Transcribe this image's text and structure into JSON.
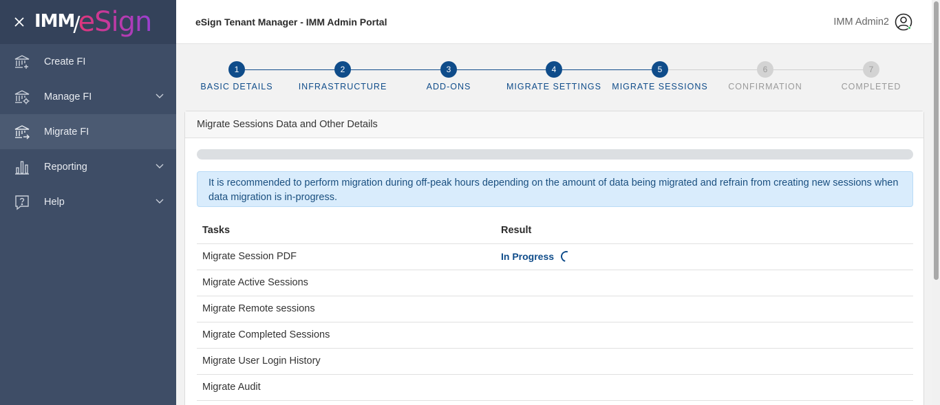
{
  "brand": {
    "imm": "IMM",
    "esign": "eSign"
  },
  "sidebar": {
    "items": [
      {
        "label": "Create FI",
        "icon": "bank-add-icon",
        "active": false,
        "expandable": false
      },
      {
        "label": "Manage FI",
        "icon": "bank-gear-icon",
        "active": false,
        "expandable": true
      },
      {
        "label": "Migrate FI",
        "icon": "bank-migrate-icon",
        "active": true,
        "expandable": false
      },
      {
        "label": "Reporting",
        "icon": "bar-chart-icon",
        "active": false,
        "expandable": true
      },
      {
        "label": "Help",
        "icon": "help-icon",
        "active": false,
        "expandable": true
      }
    ]
  },
  "header": {
    "title": "eSign Tenant Manager - IMM Admin Portal",
    "user_name": "IMM Admin2"
  },
  "stepper": {
    "steps": [
      {
        "number": "1",
        "label": "BASIC DETAILS",
        "state": "done"
      },
      {
        "number": "2",
        "label": "INFRASTRUCTURE",
        "state": "done"
      },
      {
        "number": "3",
        "label": "ADD-ONS",
        "state": "done"
      },
      {
        "number": "4",
        "label": "MIGRATE SETTINGS",
        "state": "done"
      },
      {
        "number": "5",
        "label": "MIGRATE SESSIONS",
        "state": "current"
      },
      {
        "number": "6",
        "label": "CONFIRMATION",
        "state": "pending"
      },
      {
        "number": "7",
        "label": "COMPLETED",
        "state": "pending"
      }
    ]
  },
  "card": {
    "title": "Migrate Sessions Data and Other Details",
    "progress_percent": 0,
    "alert": "It is recommended to perform migration during off-peak hours depending on the amount of data being migrated and refrain from creating new sessions when data migration is in-progress.",
    "table": {
      "headers": [
        "Tasks",
        "Result"
      ],
      "rows": [
        {
          "task": "Migrate Session PDF",
          "result": "In Progress"
        },
        {
          "task": "Migrate Active Sessions",
          "result": ""
        },
        {
          "task": "Migrate Remote sessions",
          "result": ""
        },
        {
          "task": "Migrate Completed Sessions",
          "result": ""
        },
        {
          "task": "Migrate User Login History",
          "result": ""
        },
        {
          "task": "Migrate Audit",
          "result": ""
        }
      ]
    }
  },
  "colors": {
    "primary": "#0f4c8a",
    "sidebar": "#3e4d66",
    "alert_bg": "#d9ecfc",
    "pending": "#d3d3d3"
  }
}
